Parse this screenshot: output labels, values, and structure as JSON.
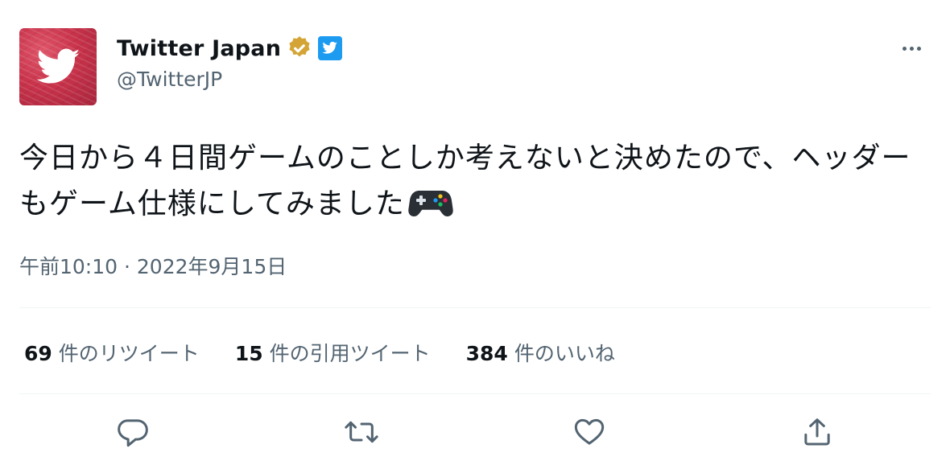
{
  "author": {
    "display_name": "Twitter Japan",
    "handle": "@TwitterJP",
    "avatar_icon": "twitter-bird-icon",
    "avatar_color": "#c9334b",
    "verified_badge_color": "#d4a536",
    "twitter_badge_color": "#1d9bf0"
  },
  "tweet": {
    "text": "今日から４日間ゲームのことしか考えないと決めたので、ヘッダーもゲーム仕様にしてみました",
    "emoji": "video-game-controller-icon",
    "timestamp": "午前10:10 · 2022年9月15日"
  },
  "stats": [
    {
      "count": "69",
      "label": "件のリツイート"
    },
    {
      "count": "15",
      "label": "件の引用ツイート"
    },
    {
      "count": "384",
      "label": "件のいいね"
    }
  ],
  "actions": [
    "reply-icon",
    "retweet-icon",
    "like-icon",
    "share-icon"
  ],
  "colors": {
    "text": "#0f1419",
    "secondary": "#536471",
    "divider": "#eff3f4"
  }
}
